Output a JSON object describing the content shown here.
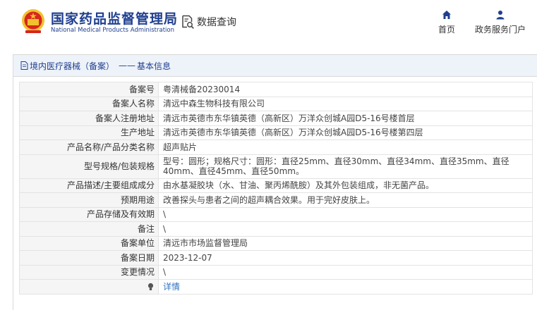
{
  "header": {
    "org_name": "国家药品监督管理局",
    "org_name_en": "National Medical Products Administration",
    "query_label": "数据查询",
    "nav": {
      "home": "首页",
      "service": "政务服务门户"
    }
  },
  "breadcrumb": {
    "category": "境内医疗器械（备案）",
    "separator": "——",
    "page": "基本信息"
  },
  "record": [
    {
      "label": "备案号",
      "value": "粤清械备20230014"
    },
    {
      "label": "备案人名称",
      "value": "清远中森生物科技有限公司"
    },
    {
      "label": "备案人注册地址",
      "value": "清远市英德市东华镇英德（高新区）万洋众创城A园D5-16号楼首层"
    },
    {
      "label": "生产地址",
      "value": "清远市英德市东华镇英德（高新区）万洋众创城A园D5-16号楼第四层"
    },
    {
      "label": "产品名称/产品分类名称",
      "value": "超声贴片"
    },
    {
      "label": "型号规格/包装规格",
      "value": "型号：圆形；规格尺寸：圆形：直径25mm、直径30mm、直径34mm、直径35mm、直径40mm、直径45mm、直径50mm。"
    },
    {
      "label": "产品描述/主要组成成分",
      "value": "由水基凝胶块（水、甘油、聚丙烯酰胺）及其外包装组成，非无菌产品。"
    },
    {
      "label": "预期用途",
      "value": "改善探头与患者之间的超声耦合效果。用于完好皮肤上。"
    },
    {
      "label": "产品存储及有效期",
      "value": "\\"
    },
    {
      "label": "备注",
      "value": "\\"
    },
    {
      "label": "备案单位",
      "value": "清远市市场监督管理局"
    },
    {
      "label": "备案日期",
      "value": "2023-12-07"
    },
    {
      "label": "变更情况",
      "value": "\\"
    }
  ],
  "detail": {
    "label": "",
    "link_text": "详情"
  },
  "colors": {
    "brand_blue": "#1f3f8f",
    "emblem_red": "#d7261e",
    "emblem_gold": "#f2c12e",
    "link": "#2f72c2"
  },
  "icons": {
    "emblem": "national-emblem-icon",
    "query": "document-search-icon",
    "home": "home-icon",
    "service": "user-icon",
    "detail": "lightbulb-icon"
  }
}
